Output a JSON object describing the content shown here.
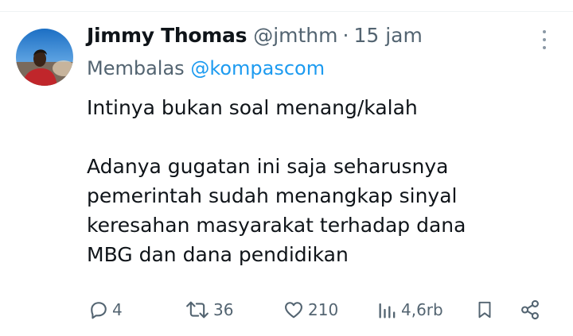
{
  "tweet": {
    "author_name": "Jimmy Thomas",
    "author_handle": "@jmthm",
    "separator": "·",
    "timestamp": "15 jam",
    "reply_prefix": "Membalas",
    "reply_to": "@kompascom",
    "body_paragraphs": [
      [
        "Intinya bukan soal menang/kalah"
      ],
      [
        "Adanya gugatan ini saja seharusnya",
        "pemerintah sudah menangkap sinyal",
        "keresahan masyarakat terhadap dana",
        "MBG dan dana pendidikan"
      ]
    ]
  },
  "actions": {
    "reply_count": "4",
    "retweet_count": "36",
    "like_count": "210",
    "views_count": "4,6rb"
  },
  "icons": {
    "reply": "reply-icon",
    "retweet": "retweet-icon",
    "like": "heart-icon",
    "views": "views-icon",
    "bookmark": "bookmark-icon",
    "share": "share-icon",
    "more": "more-options-icon"
  },
  "colors": {
    "text_primary": "#0f1419",
    "text_secondary": "#536471",
    "link": "#1d9bf0",
    "icon": "#536471"
  }
}
